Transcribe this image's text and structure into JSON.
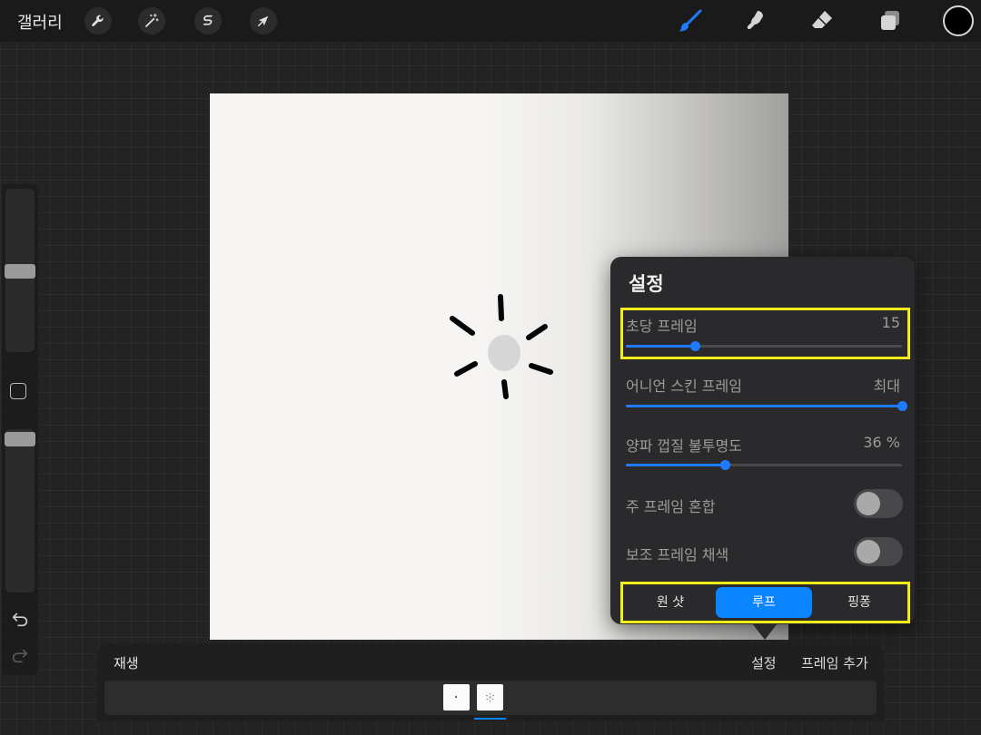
{
  "topbar": {
    "gallery_label": "갤러리",
    "left_tools": [
      "wrench-icon",
      "magic-wand-icon",
      "selection-s-icon",
      "transform-arrow-icon"
    ],
    "right_tools": [
      "brush-icon",
      "smudge-icon",
      "eraser-icon",
      "layers-icon"
    ],
    "active_tool": "brush-icon",
    "current_color": "#000000",
    "accent": "#0a84ff"
  },
  "sidebar": {
    "brush_size_level": 0.5,
    "opacity_level": 0.0
  },
  "settings": {
    "title": "설정",
    "fps": {
      "label": "초당 프레임",
      "value": "15",
      "fraction": 0.25
    },
    "onion_frames": {
      "label": "어니언 스킨 프레임",
      "value": "최대",
      "fraction": 1.0
    },
    "onion_opacity": {
      "label": "양파 껍질 불투명도",
      "value": "36 %",
      "fraction": 0.36
    },
    "blend_primary": {
      "label": "주 프레임 혼합",
      "on": false
    },
    "color_secondary": {
      "label": "보조 프레임 채색",
      "on": false
    },
    "playback_modes": [
      "원 샷",
      "루프",
      "핑퐁"
    ],
    "selected_mode": "루프"
  },
  "timeline": {
    "play_label": "재생",
    "settings_label": "설정",
    "add_frame_label": "프레임 추가",
    "frame_count": 2,
    "selected_frame": 2
  }
}
